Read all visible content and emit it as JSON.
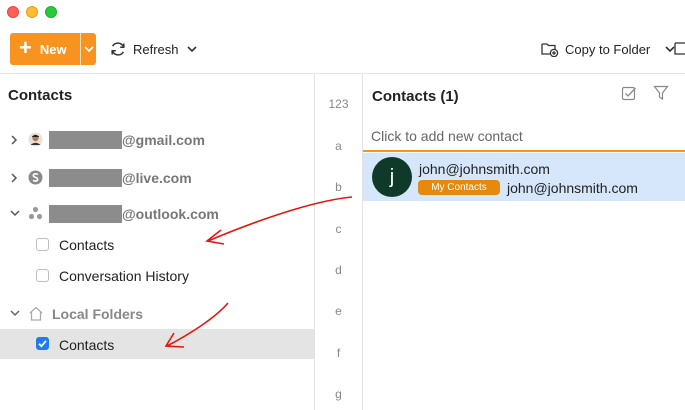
{
  "window": {
    "controls": [
      "close",
      "minimize",
      "zoom"
    ]
  },
  "toolbar": {
    "new_label": "New",
    "refresh_label": "Refresh",
    "copy_to_label": "Copy to Folder"
  },
  "left_panel": {
    "title": "Contacts",
    "accounts": [
      {
        "domain": "@gmail.com",
        "icon": "avatar-photo-icon",
        "expanded": false
      },
      {
        "domain": "@live.com",
        "icon": "skype-icon",
        "expanded": false
      },
      {
        "domain": "@outlook.com",
        "icon": "people-icon",
        "expanded": true
      }
    ],
    "outlook_folders": [
      {
        "label": "Contacts",
        "checked": false
      },
      {
        "label": "Conversation History",
        "checked": false
      }
    ],
    "local_folders": {
      "label": "Local Folders",
      "folders": [
        {
          "label": "Contacts",
          "checked": true,
          "selected": true
        }
      ]
    }
  },
  "alphabet_index": [
    "123",
    "a",
    "b",
    "c",
    "d",
    "e",
    "f",
    "g"
  ],
  "contacts_panel": {
    "title": "Contacts (1)",
    "add_placeholder": "Click to add new contact",
    "contacts": [
      {
        "initial": "j",
        "name": "john@johnsmith.com",
        "category": "My Contacts",
        "email": "john@johnsmith.com"
      }
    ]
  },
  "colors": {
    "accent": "#f7931e",
    "selection": "#d6e7fb",
    "badge": "#e58a0f",
    "avatar": "#0f3a2a",
    "annotation": "#e8140c"
  }
}
